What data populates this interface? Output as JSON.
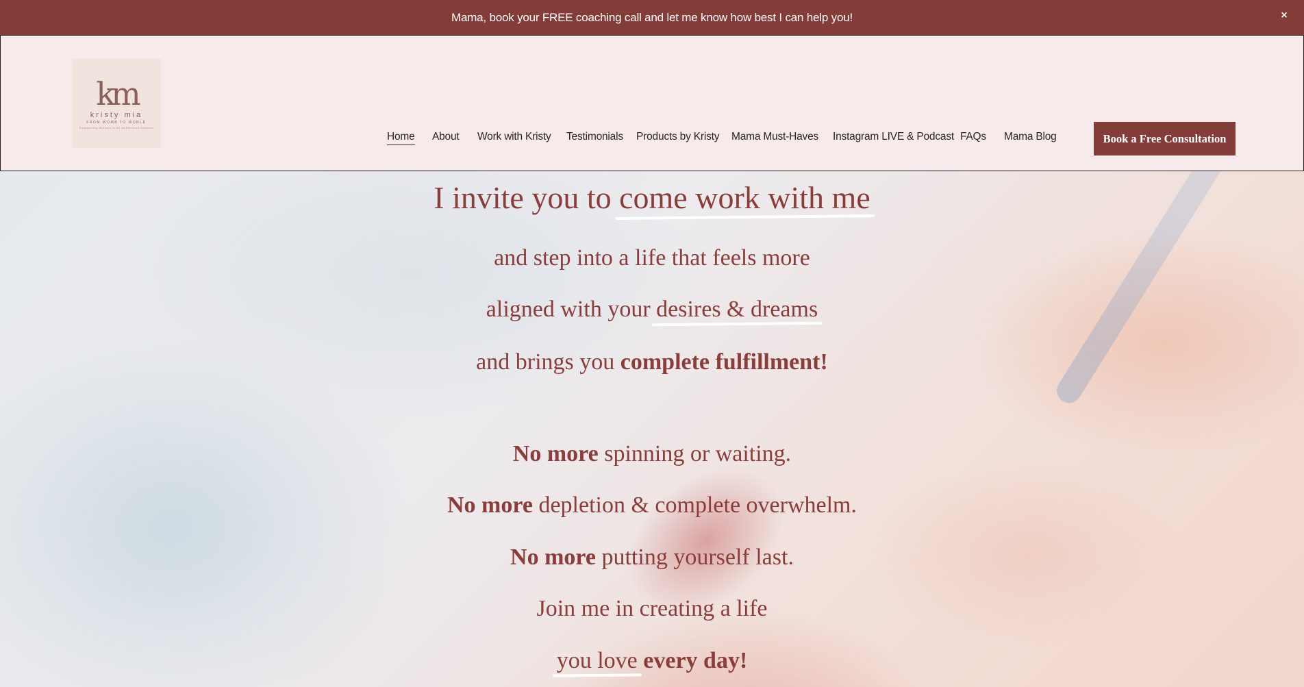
{
  "announcement": {
    "text": "Mama, book your FREE coaching call and let me know how best I can help you!",
    "close_label": "×"
  },
  "logo": {
    "mark": "km",
    "name": "kristy mia",
    "tagline": "FROM WOMB TO WORLD",
    "subtagline": "Empowering Mothers in All Motherhood Seasons"
  },
  "nav": {
    "items": [
      {
        "label": "Home"
      },
      {
        "label": "About"
      },
      {
        "label": "Work with Kristy"
      },
      {
        "label": "Testimonials"
      },
      {
        "label": "Products by Kristy"
      },
      {
        "label": "Mama Must-Haves"
      },
      {
        "label": "Instagram LIVE & Podcast"
      },
      {
        "label": "FAQs"
      },
      {
        "label": "Mama Blog"
      }
    ],
    "cta": "Book a Free Consultation"
  },
  "hero": {
    "line1_a": "I invite you to ",
    "line1_b": "come work with me",
    "line2": "and step into a life that feels more",
    "line3_a": "aligned with your ",
    "line3_b": "desires & dreams",
    "line4_a": "and brings you ",
    "line4_b": "complete fulfillment!",
    "line5_a": "No more",
    "line5_b": " spinning or waiting.",
    "line6_a": "No more",
    "line6_b": " depletion & complete overwhelm.",
    "line7_a": "No more",
    "line7_b": " putting yourself last.",
    "line8": "Join me in creating a life",
    "line9_a": "you love",
    "line9_b": " every day!"
  },
  "colors": {
    "brand": "#843c38",
    "text_accent": "#8a3d3a",
    "header_bg": "#f6eaea"
  }
}
